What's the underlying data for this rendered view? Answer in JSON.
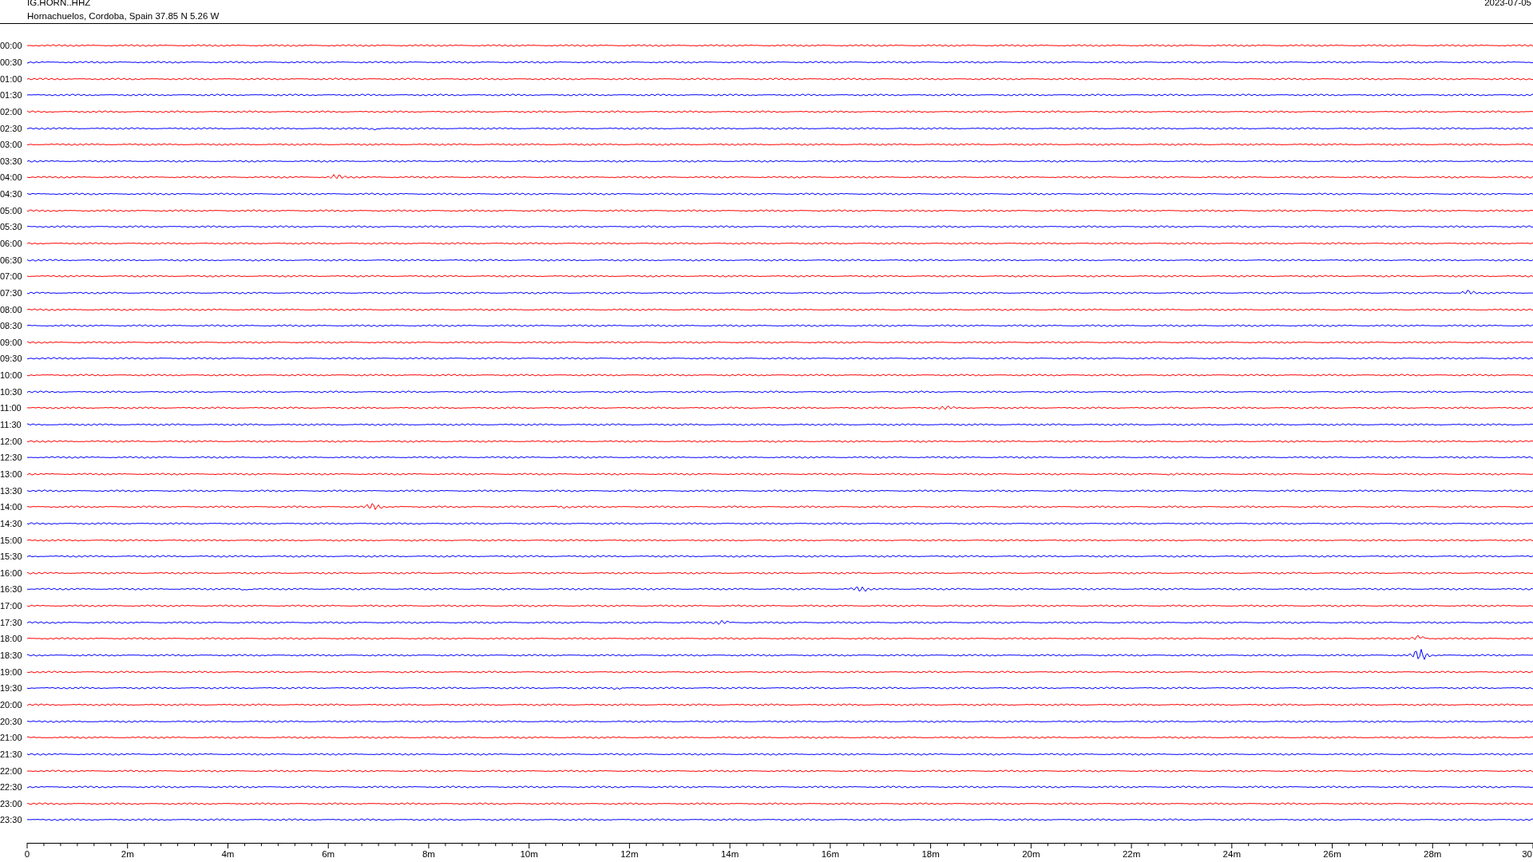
{
  "header": {
    "station": "IG.HORN..HHZ",
    "location": "Hornachuelos, Cordoba, Spain  37.85 N 5.26 W",
    "date": "2023-07-05"
  },
  "traces": [
    {
      "time": "00:00",
      "color": "#ff0000"
    },
    {
      "time": "00:30",
      "color": "#0000ff"
    },
    {
      "time": "01:00",
      "color": "#ff0000"
    },
    {
      "time": "01:30",
      "color": "#0000ff"
    },
    {
      "time": "02:00",
      "color": "#ff0000"
    },
    {
      "time": "02:30",
      "color": "#0000ff"
    },
    {
      "time": "03:00",
      "color": "#ff0000"
    },
    {
      "time": "03:30",
      "color": "#0000ff"
    },
    {
      "time": "04:00",
      "color": "#ff0000"
    },
    {
      "time": "04:30",
      "color": "#0000ff"
    },
    {
      "time": "05:00",
      "color": "#ff0000"
    },
    {
      "time": "05:30",
      "color": "#0000ff"
    },
    {
      "time": "06:00",
      "color": "#ff0000"
    },
    {
      "time": "06:30",
      "color": "#0000ff"
    },
    {
      "time": "07:00",
      "color": "#ff0000"
    },
    {
      "time": "07:30",
      "color": "#0000ff"
    },
    {
      "time": "08:00",
      "color": "#ff0000"
    },
    {
      "time": "08:30",
      "color": "#0000ff"
    },
    {
      "time": "09:00",
      "color": "#ff0000"
    },
    {
      "time": "09:30",
      "color": "#0000ff"
    },
    {
      "time": "10:00",
      "color": "#ff0000"
    },
    {
      "time": "10:30",
      "color": "#0000ff"
    },
    {
      "time": "11:00",
      "color": "#ff0000"
    },
    {
      "time": "11:30",
      "color": "#0000ff"
    },
    {
      "time": "12:00",
      "color": "#ff0000"
    },
    {
      "time": "12:30",
      "color": "#0000ff"
    },
    {
      "time": "13:00",
      "color": "#ff0000"
    },
    {
      "time": "13:30",
      "color": "#0000ff"
    },
    {
      "time": "14:00",
      "color": "#ff0000"
    },
    {
      "time": "14:30",
      "color": "#0000ff"
    },
    {
      "time": "15:00",
      "color": "#ff0000"
    },
    {
      "time": "15:30",
      "color": "#0000ff"
    },
    {
      "time": "16:00",
      "color": "#ff0000"
    },
    {
      "time": "16:30",
      "color": "#0000ff"
    },
    {
      "time": "17:00",
      "color": "#ff0000"
    },
    {
      "time": "17:30",
      "color": "#0000ff"
    },
    {
      "time": "18:00",
      "color": "#ff0000"
    },
    {
      "time": "18:30",
      "color": "#0000ff"
    },
    {
      "time": "19:00",
      "color": "#ff0000"
    },
    {
      "time": "19:30",
      "color": "#0000ff"
    },
    {
      "time": "20:00",
      "color": "#ff0000"
    },
    {
      "time": "20:30",
      "color": "#0000ff"
    },
    {
      "time": "21:00",
      "color": "#ff0000"
    },
    {
      "time": "21:30",
      "color": "#0000ff"
    },
    {
      "time": "22:00",
      "color": "#ff0000"
    },
    {
      "time": "22:30",
      "color": "#0000ff"
    },
    {
      "time": "23:00",
      "color": "#ff0000"
    },
    {
      "time": "23:30",
      "color": "#0000ff"
    }
  ],
  "x_axis": {
    "ticks": [
      "0",
      "2m",
      "4m",
      "6m",
      "8m",
      "10m",
      "12m",
      "14m",
      "16m",
      "18m",
      "20m",
      "22m",
      "24m",
      "26m",
      "28m",
      "30"
    ]
  }
}
